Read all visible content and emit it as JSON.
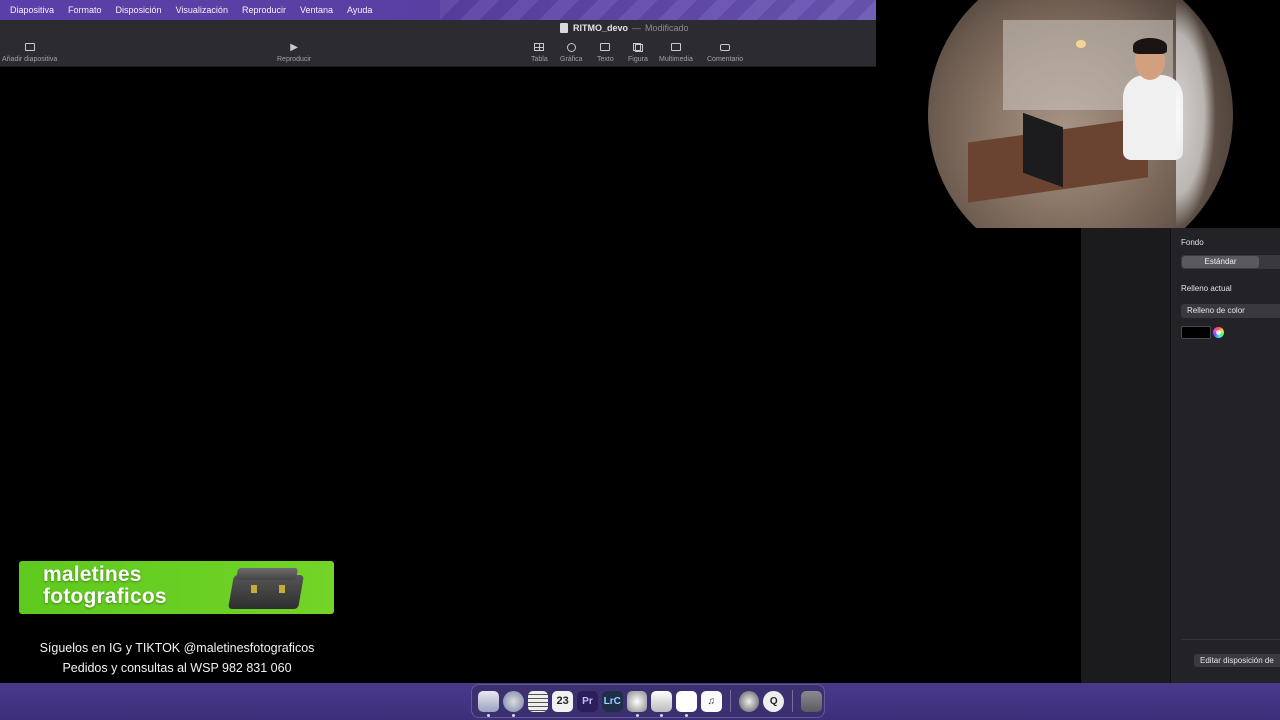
{
  "menubar": {
    "items": [
      "Diapositiva",
      "Formato",
      "Disposición",
      "Visualización",
      "Reproducir",
      "Ventana",
      "Ayuda"
    ]
  },
  "toolbar": {
    "doc_name": "RITMO_devo",
    "doc_separator": "—",
    "doc_status": "Modificado",
    "add_slide": "Añadir diapositiva",
    "play": "Reproducir",
    "table": "Tabla",
    "chart": "Gráfica",
    "text": "Texto",
    "shape": "Figura",
    "media": "Multimedia",
    "comment": "Comentario"
  },
  "inspector": {
    "background_label": "Fondo",
    "segment_active": "Estándar",
    "fill_label": "Relleno actual",
    "fill_select": "Relleno de color",
    "fill_color": "#000000",
    "edit_layout_button": "Editar disposición de"
  },
  "overlay": {
    "banner_line1": "maletines",
    "banner_line2": "fotograficos",
    "social_line1": "Síguelos en IG y TIKTOK @maletinesfotograficos",
    "social_line2": "Pedidos y consultas al WSP 982 831 060"
  },
  "dock": {
    "calendar_day": "23",
    "apps": [
      "finder-icon",
      "safari-icon",
      "notes-icon",
      "calendar-icon",
      "premiere-icon",
      "lightroom-icon",
      "davinci-icon",
      "keynote-icon",
      "discord-icon",
      "music-icon",
      "activity-icon",
      "quicktime-icon",
      "trash-icon"
    ]
  }
}
